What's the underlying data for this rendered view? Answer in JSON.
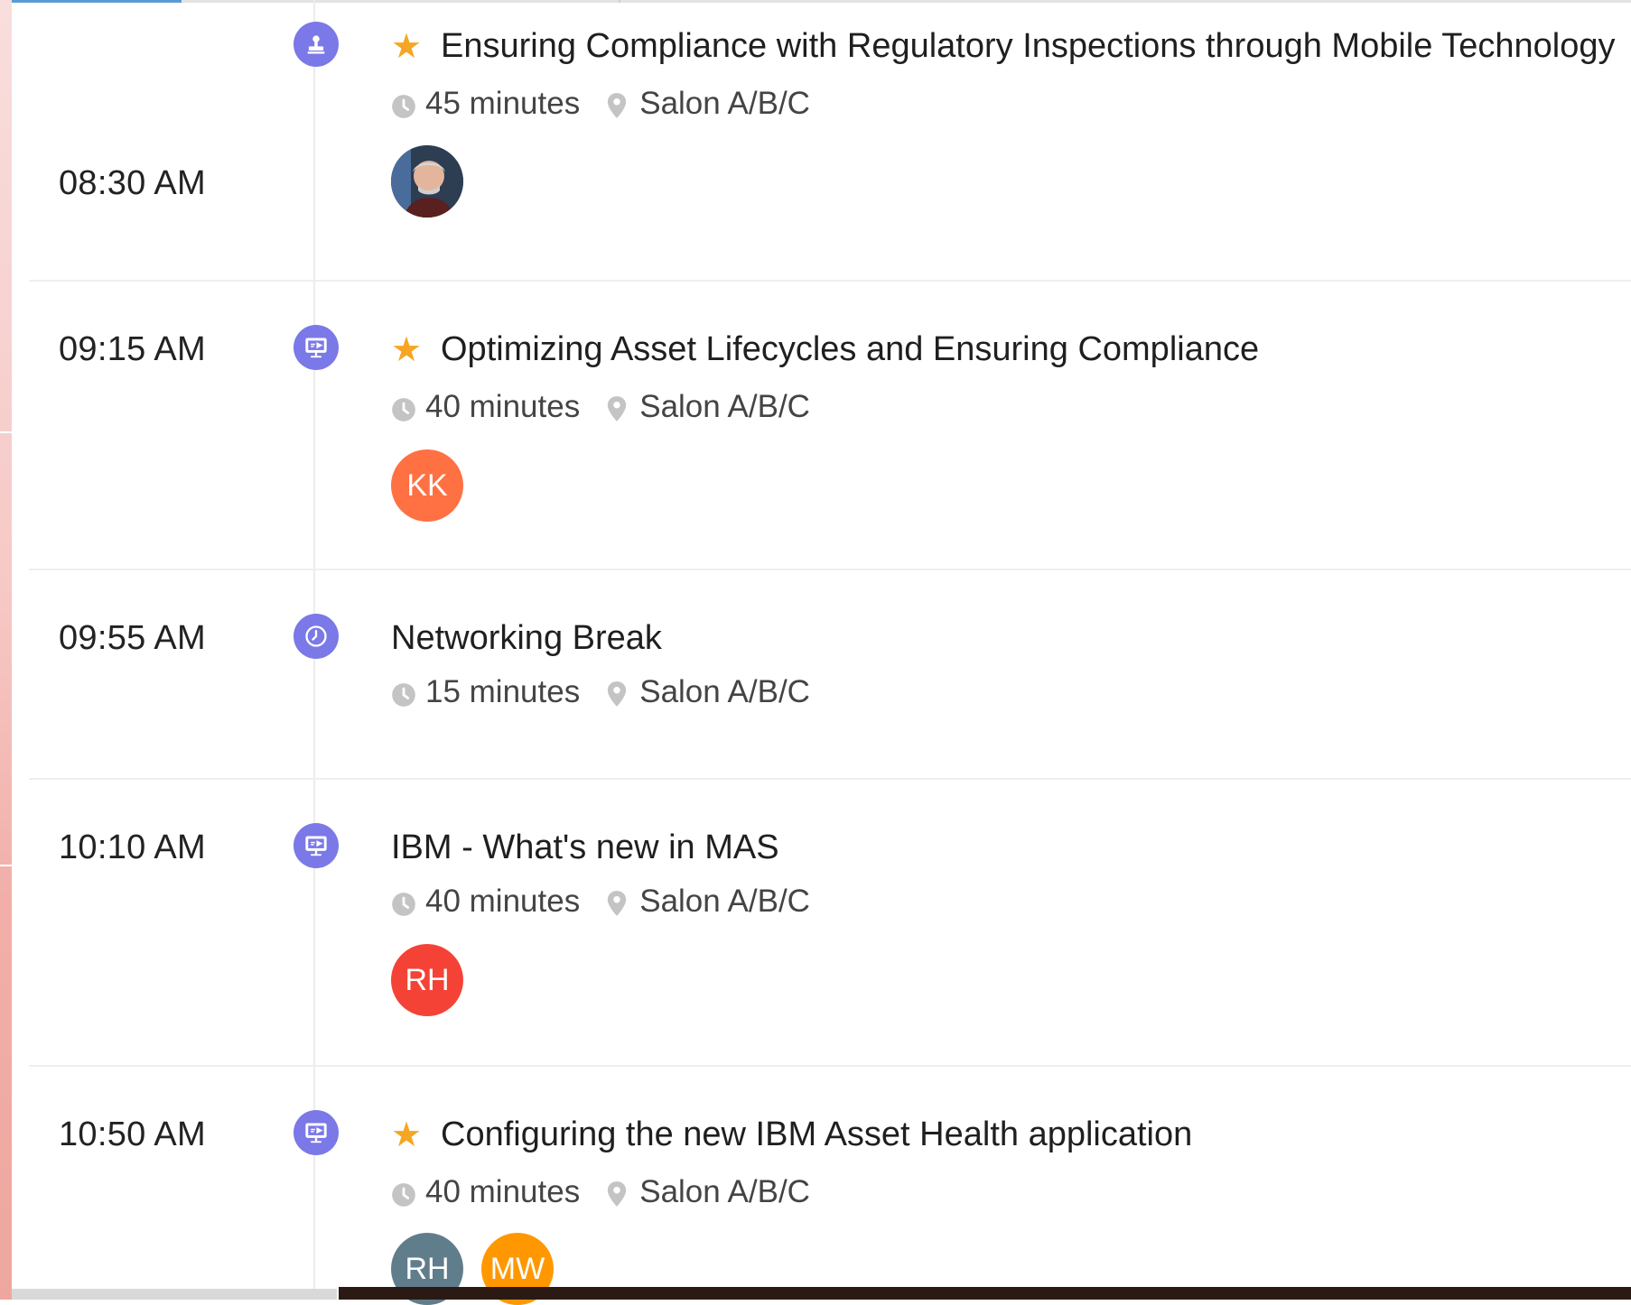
{
  "colors": {
    "accent": "#7b78e8",
    "star": "#f5a623",
    "avatar_kk": "#ff7043",
    "avatar_rh_red": "#f44336",
    "avatar_rh_slate": "#607d8b",
    "avatar_mw": "#ff9800"
  },
  "sessions": [
    {
      "time": "08:30 AM",
      "icon": "certificate-icon",
      "starred": true,
      "title": "Ensuring Compliance with Regulatory Inspections through Mobile Technology",
      "duration": "45 minutes",
      "location": "Salon A/B/C",
      "speakers": [
        {
          "type": "photo"
        }
      ]
    },
    {
      "time": "09:15 AM",
      "icon": "presentation-icon",
      "starred": true,
      "title": "Optimizing Asset Lifecycles and Ensuring Compliance",
      "duration": "40 minutes",
      "location": "Salon A/B/C",
      "speakers": [
        {
          "initials": "KK"
        }
      ]
    },
    {
      "time": "09:55 AM",
      "icon": "break-icon",
      "starred": false,
      "title": "Networking Break",
      "duration": "15 minutes",
      "location": "Salon A/B/C",
      "speakers": []
    },
    {
      "time": "10:10 AM",
      "icon": "presentation-icon",
      "starred": false,
      "title": "IBM - What's new in MAS",
      "duration": "40 minutes",
      "location": "Salon A/B/C",
      "speakers": [
        {
          "initials": "RH"
        }
      ]
    },
    {
      "time": "10:50 AM",
      "icon": "presentation-icon",
      "starred": true,
      "title": "Configuring the new IBM Asset Health application",
      "duration": "40 minutes",
      "location": "Salon A/B/C",
      "speakers": [
        {
          "initials": "RH"
        },
        {
          "initials": "MW"
        }
      ]
    }
  ]
}
